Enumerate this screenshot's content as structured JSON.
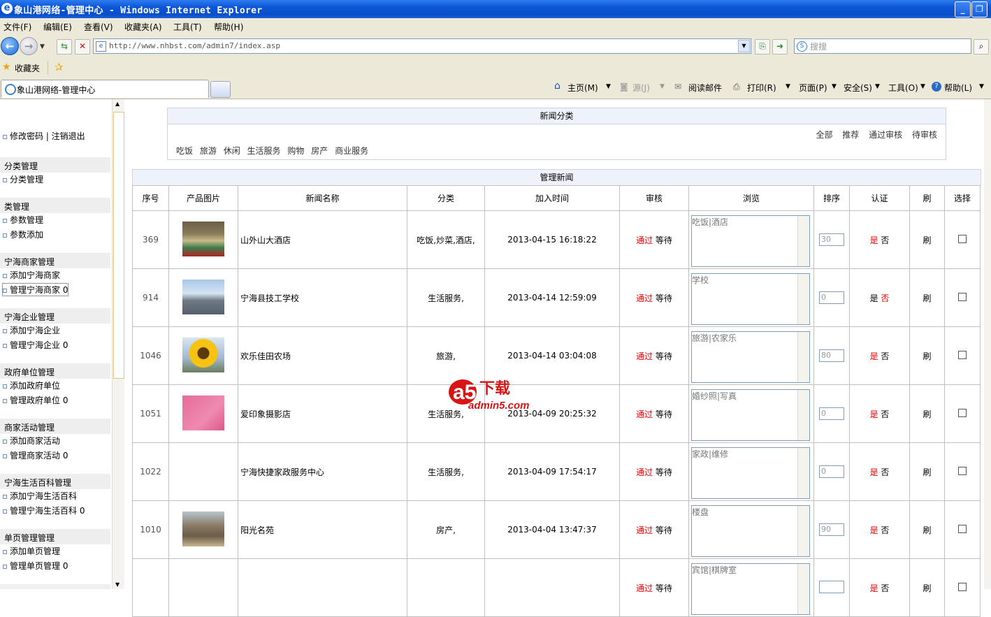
{
  "window": {
    "title": "象山港网络-管理中心 - Windows Internet Explorer"
  },
  "menu": [
    "文件(F)",
    "编辑(E)",
    "查看(V)",
    "收藏夹(A)",
    "工具(T)",
    "帮助(H)"
  ],
  "address": {
    "url": "http://www.nhbst.com/admin7/index.asp",
    "search_placeholder": "搜搜"
  },
  "favorites": {
    "label": "收藏夹"
  },
  "tab": {
    "title": "象山港网络-管理中心"
  },
  "commands": {
    "home": "主页(M)",
    "feeds": "源(J)",
    "mail": "阅读邮件",
    "print": "打印(R)",
    "page": "页面(P)",
    "safety": "安全(S)",
    "tools": "工具(O)",
    "help": "帮助(L)"
  },
  "sidebar": {
    "top_links": "修改密码 | 注销退出",
    "groups": [
      {
        "title": "分类管理",
        "items": [
          "分类管理"
        ]
      },
      {
        "title": "类管理",
        "items": [
          "参数管理",
          "参数添加"
        ]
      },
      {
        "title": "宁海商家管理",
        "items": [
          "添加宁海商家",
          "管理宁海商家 0"
        ]
      },
      {
        "title": "宁海企业管理",
        "items": [
          "添加宁海企业",
          "管理宁海企业 0"
        ]
      },
      {
        "title": "政府单位管理",
        "items": [
          "添加政府单位",
          "管理政府单位 0"
        ]
      },
      {
        "title": "商家活动管理",
        "items": [
          "添加商家活动",
          "管理商家活动 0"
        ]
      },
      {
        "title": "宁海生活百科管理",
        "items": [
          "添加宁海生活百科",
          "管理宁海生活百科 0"
        ]
      },
      {
        "title": "单页管理管理",
        "items": [
          "添加单页管理",
          "管理单页管理 0"
        ]
      }
    ]
  },
  "category_box": {
    "title": "新闻分类",
    "filters": [
      "全部",
      "推荐",
      "通过审核",
      "待审核"
    ],
    "categories": [
      "吃饭",
      "旅游",
      "休闲",
      "生活服务",
      "购物",
      "房产",
      "商业服务"
    ]
  },
  "table": {
    "title": "管理新闻",
    "headers": [
      "序号",
      "产品图片",
      "新闻名称",
      "分类",
      "加入时间",
      "审核",
      "浏览",
      "排序",
      "认证",
      "刷",
      "选择"
    ],
    "approve_label": "通过",
    "wait_label": "等待",
    "yes_label": "是",
    "no_label": "否",
    "refresh_label": "刷",
    "rows": [
      {
        "id": "369",
        "name": "山外山大酒店",
        "category": "吃饭,炒菜,酒店,",
        "time": "2013-04-15 16:18:22",
        "tags": "吃饭|酒店",
        "sort": "30",
        "thumb": "hotel",
        "cert": "yes"
      },
      {
        "id": "914",
        "name": "宁海县技工学校",
        "category": "生活服务,",
        "time": "2013-04-14 12:59:09",
        "tags": "学校",
        "sort": "0",
        "thumb": "school",
        "cert": "no"
      },
      {
        "id": "1046",
        "name": "欢乐佳田农场",
        "category": "旅游,",
        "time": "2013-04-14 03:04:08",
        "tags": "旅游|农家乐",
        "sort": "80",
        "thumb": "flower",
        "cert": "yes"
      },
      {
        "id": "1051",
        "name": "爱印象摄影店",
        "category": "生活服务,",
        "time": "2013-04-09 20:25:32",
        "tags": "婚纱照|写真",
        "sort": "0",
        "thumb": "pink",
        "cert": "yes"
      },
      {
        "id": "1022",
        "name": "宁海快捷家政服务中心",
        "category": "生活服务,",
        "time": "2013-04-09 17:54:17",
        "tags": "家政|维修",
        "sort": "0",
        "thumb": "none",
        "cert": "yes"
      },
      {
        "id": "1010",
        "name": "阳光名苑",
        "category": "房产,",
        "time": "2013-04-04 13:47:37",
        "tags": "楼盘",
        "sort": "90",
        "thumb": "building",
        "cert": "yes"
      },
      {
        "id": "",
        "name": "",
        "category": "",
        "time": "",
        "tags": "宾馆|棋牌室",
        "sort": "",
        "thumb": "none",
        "cert": "yes"
      }
    ]
  },
  "watermark": {
    "logo": "a5",
    "text1": "下载",
    "text2": "admin5.com"
  }
}
